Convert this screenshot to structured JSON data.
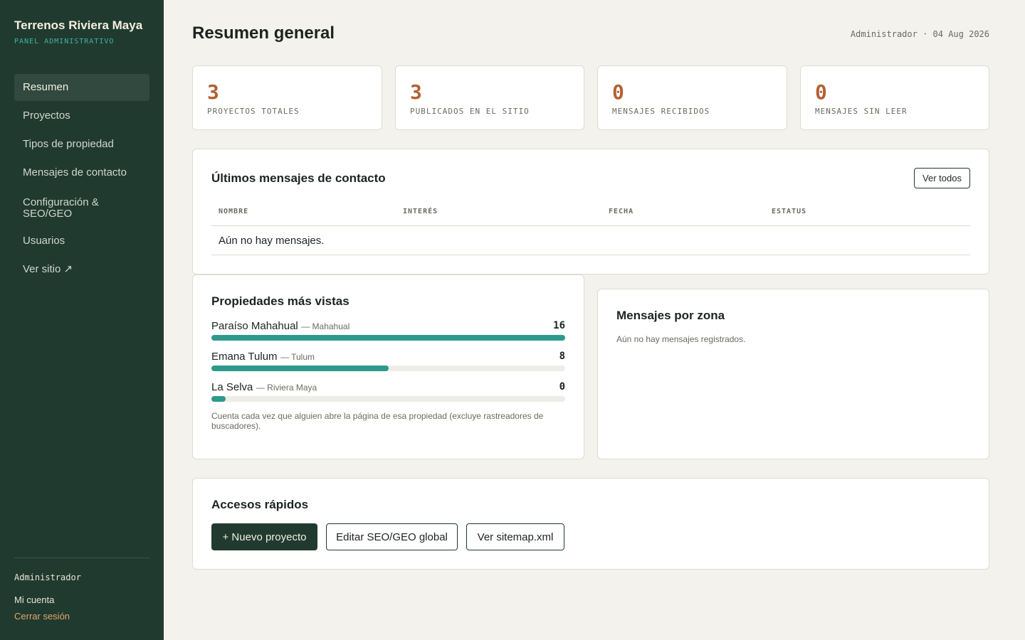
{
  "brand": {
    "title": "Terrenos Riviera Maya",
    "subtitle": "PANEL ADMINISTRATIVO"
  },
  "nav": {
    "items": [
      {
        "label": "Resumen",
        "active": true
      },
      {
        "label": "Proyectos"
      },
      {
        "label": "Tipos de propiedad"
      },
      {
        "label": "Mensajes de contacto"
      },
      {
        "label": "Configuración & SEO/GEO"
      },
      {
        "label": "Usuarios"
      },
      {
        "label": "Ver sitio ↗"
      }
    ]
  },
  "sidebar_footer": {
    "user": "Administrador",
    "account": "Mi cuenta",
    "logout": "Cerrar sesión"
  },
  "header": {
    "title": "Resumen general",
    "meta": "Administrador · 04 Aug 2026"
  },
  "stats": [
    {
      "value": "3",
      "label": "PROYECTOS TOTALES"
    },
    {
      "value": "3",
      "label": "PUBLICADOS EN EL SITIO"
    },
    {
      "value": "0",
      "label": "MENSAJES RECIBIDOS"
    },
    {
      "value": "0",
      "label": "MENSAJES SIN LEER"
    }
  ],
  "messages": {
    "title": "Últimos mensajes de contacto",
    "view_all": "Ver todos",
    "columns": [
      "NOMBRE",
      "INTERÉS",
      "FECHA",
      "ESTATUS"
    ],
    "empty": "Aún no hay mensajes."
  },
  "views": {
    "title": "Propiedades más vistas",
    "items": [
      {
        "name": "Paraíso Mahahual",
        "location": "— Mahahual",
        "value": "16",
        "fraction": 1.0
      },
      {
        "name": "Emana Tulum",
        "location": "— Tulum",
        "value": "8",
        "fraction": 0.5
      },
      {
        "name": "La Selva",
        "location": "— Riviera Maya",
        "value": "0",
        "fraction": 0.04
      }
    ],
    "note": "Cuenta cada vez que alguien abre la página de esa propiedad (excluye rastreadores de buscadores)."
  },
  "zones": {
    "title": "Mensajes por zona",
    "empty": "Aún no hay mensajes registrados."
  },
  "quick": {
    "title": "Accesos rápidos",
    "new_project": "+ Nuevo proyecto",
    "edit_seo": "Editar SEO/GEO global",
    "sitemap": "Ver sitemap.xml"
  },
  "colors": {
    "sidebar": "#213a2f",
    "accent": "#b36134",
    "bar": "#2e9a8c",
    "brand_sub": "#3fb3a3"
  }
}
